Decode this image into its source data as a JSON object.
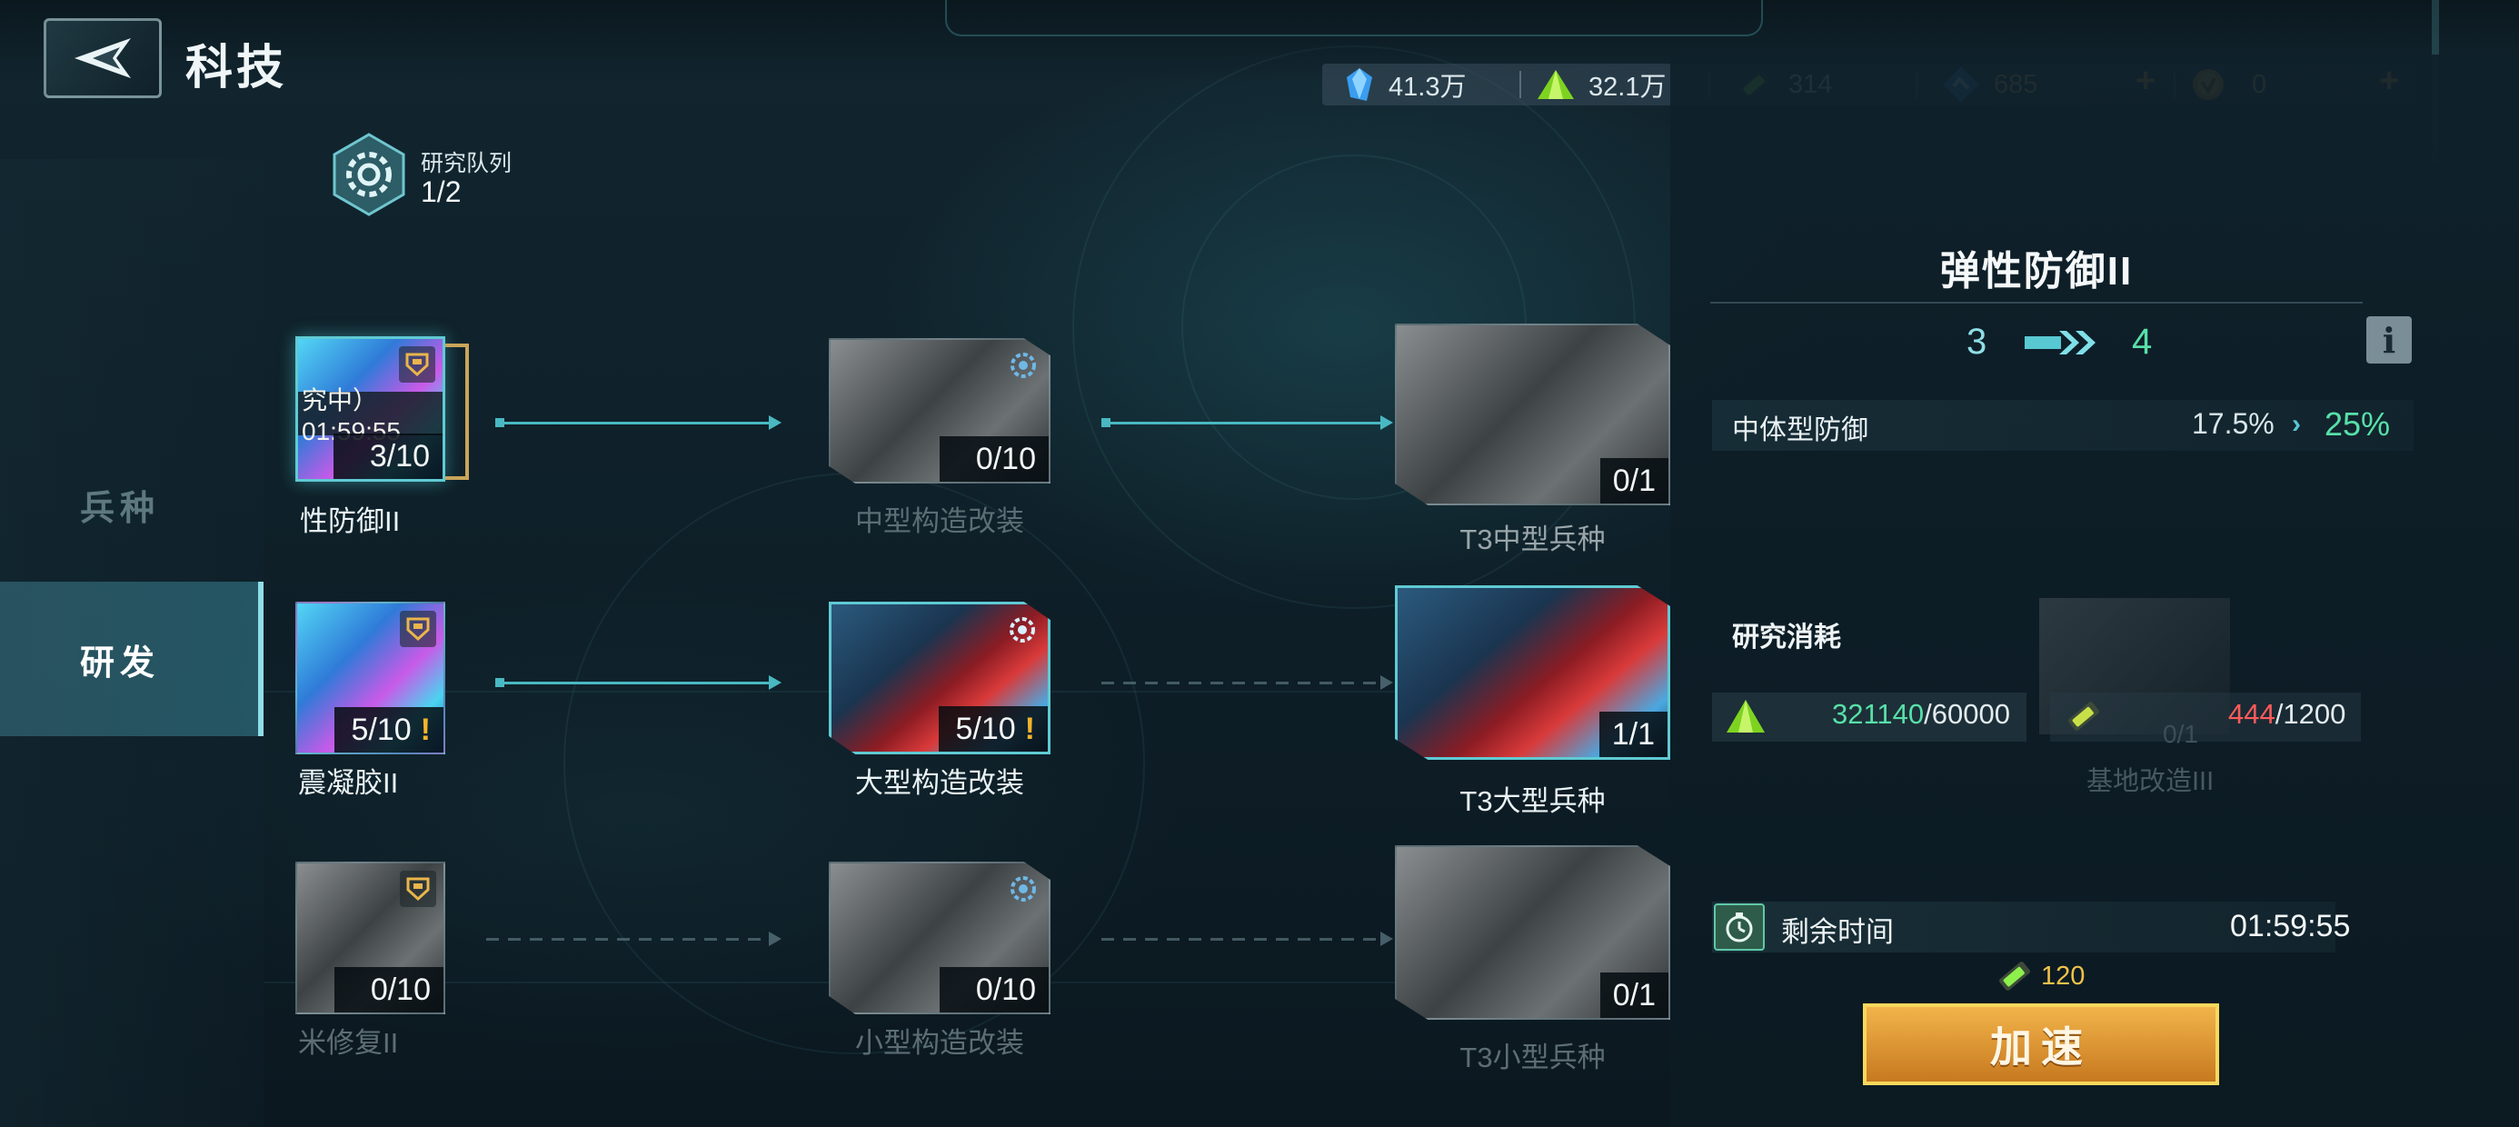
{
  "header": {
    "title": "科技"
  },
  "resources": [
    {
      "icon": "blue-crystal-icon",
      "value": "41.3万"
    },
    {
      "icon": "green-crystal-icon",
      "value": "32.1万"
    },
    {
      "icon": "green-battery-icon",
      "value": "314"
    },
    {
      "icon": "blue-ticket-icon",
      "value": "685"
    },
    {
      "icon": "gold-coin-icon",
      "value": "0"
    }
  ],
  "plus_sign": "+",
  "nav": {
    "items": [
      {
        "label": "兵种"
      },
      {
        "label": "研发"
      }
    ]
  },
  "queue": {
    "label": "研究队列",
    "count": "1/2"
  },
  "techs": {
    "r1c1": {
      "name": "性防御II",
      "count": "3/10",
      "timer": "究中）01:59:55"
    },
    "r1c2": {
      "name": "中型构造改装",
      "count": "0/10"
    },
    "r1c3": {
      "name": "T3中型兵种",
      "count": "0/1"
    },
    "r2c1": {
      "name": "震凝胶II",
      "count": "5/10",
      "warn": "!"
    },
    "r2c2": {
      "name": "大型构造改装",
      "count": "5/10",
      "warn": "!"
    },
    "r2c3": {
      "name": "T3大型兵种",
      "count": "1/1"
    },
    "r3c1": {
      "name": "米修复II",
      "count": "0/10"
    },
    "r3c2": {
      "name": "小型构造改装",
      "count": "0/10"
    },
    "r3c3": {
      "name": "T3小型兵种",
      "count": "0/1"
    }
  },
  "detail": {
    "title": "弹性防御II",
    "level_from": "3",
    "level_to": "4",
    "info_label": "i",
    "stat": {
      "name": "中体型防御",
      "from": "17.5%",
      "chevron": "›",
      "to": "25%"
    },
    "cost_title": "研究消耗",
    "costs": [
      {
        "icon": "green-crystal-icon",
        "have": "321140",
        "sep": "/",
        "need": "60000"
      },
      {
        "icon": "green-battery-icon",
        "have": "444",
        "sep": "/",
        "need": "1200"
      }
    ],
    "ghost": {
      "name": "基地改造III",
      "count": "0/1"
    },
    "time_label": "剩余时间",
    "time_value": "01:59:55",
    "speedup_cost": "120",
    "speedup_label": "加速"
  },
  "colors": {
    "accent": "#49b8c2",
    "positive": "#58e0a8",
    "negative": "#ff5a5a",
    "gold": "#f0a63a"
  }
}
